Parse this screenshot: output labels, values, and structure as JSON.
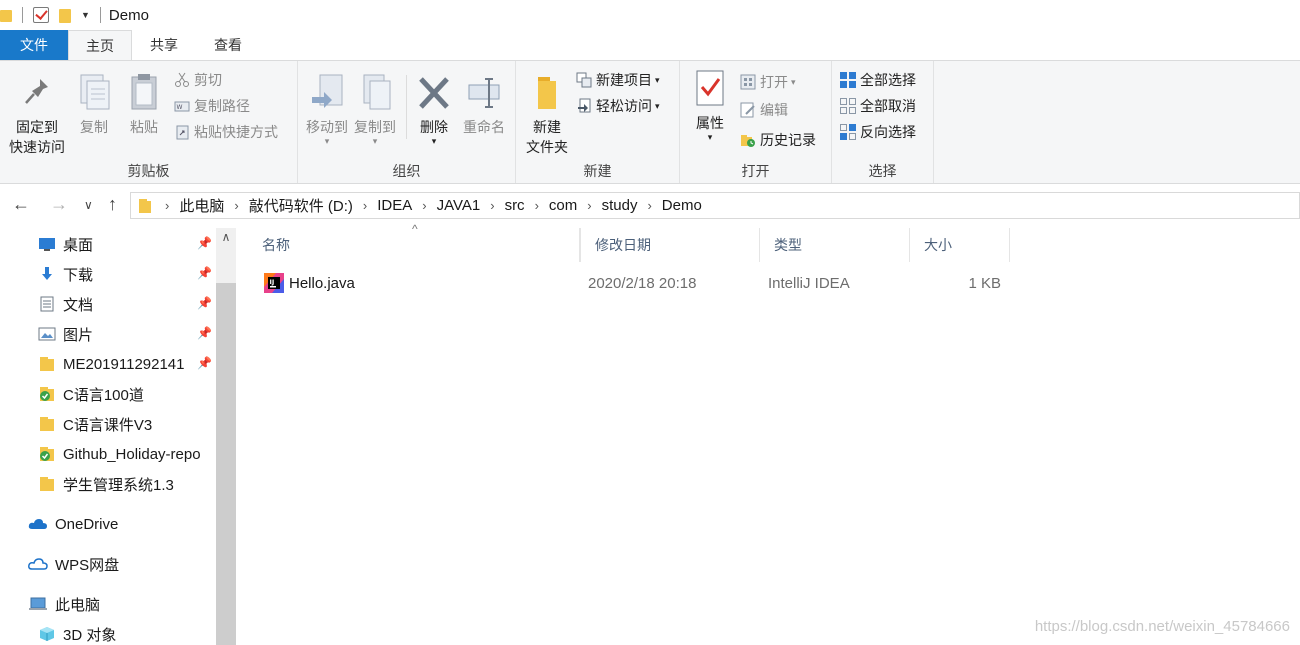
{
  "window": {
    "title": "Demo"
  },
  "quick_access_toolbar": {
    "icons": [
      "folder-icon",
      "properties-check-icon",
      "new-folder-icon",
      "customize-dropdown-icon"
    ]
  },
  "tabs": [
    {
      "label": "文件"
    },
    {
      "label": "主页"
    },
    {
      "label": "共享"
    },
    {
      "label": "查看"
    }
  ],
  "ribbon": {
    "clipboard": {
      "label": "剪贴板",
      "pin_line1": "固定到",
      "pin_line2": "快速访问",
      "copy": "复制",
      "paste": "粘贴",
      "cut": "剪切",
      "copy_path": "复制路径",
      "paste_shortcut": "粘贴快捷方式"
    },
    "organize": {
      "label": "组织",
      "move_to": "移动到",
      "copy_to": "复制到",
      "delete": "删除",
      "rename": "重命名"
    },
    "new": {
      "label": "新建",
      "new_folder_line1": "新建",
      "new_folder_line2": "文件夹",
      "new_item": "新建项目",
      "easy_access": "轻松访问"
    },
    "open": {
      "label": "打开",
      "properties": "属性",
      "open": "打开",
      "edit": "编辑",
      "history": "历史记录"
    },
    "select": {
      "label": "选择",
      "select_all": "全部选择",
      "select_none": "全部取消",
      "invert": "反向选择"
    }
  },
  "address": {
    "breadcrumbs": [
      "此电脑",
      "敲代码软件 (D:)",
      "IDEA",
      "JAVA1",
      "src",
      "com",
      "study",
      "Demo"
    ]
  },
  "nav_pane": {
    "items": [
      {
        "label": "桌面",
        "icon": "desktop-icon",
        "pinned": true
      },
      {
        "label": "下载",
        "icon": "download-icon",
        "pinned": true
      },
      {
        "label": "文档",
        "icon": "documents-icon",
        "pinned": true
      },
      {
        "label": "图片",
        "icon": "pictures-icon",
        "pinned": true
      },
      {
        "label": "ME201911292141",
        "icon": "folder-icon",
        "pinned": true
      },
      {
        "label": "C语言100道",
        "icon": "synced-folder-icon",
        "pinned": false
      },
      {
        "label": "C语言课件V3",
        "icon": "folder-icon",
        "pinned": false
      },
      {
        "label": "Github_Holiday-repo",
        "icon": "synced-folder-icon",
        "pinned": false
      },
      {
        "label": "学生管理系统1.3",
        "icon": "folder-icon",
        "pinned": false
      },
      {
        "label": "OneDrive",
        "icon": "onedrive-icon",
        "pinned": false
      },
      {
        "label": "WPS网盘",
        "icon": "wps-cloud-icon",
        "pinned": false
      },
      {
        "label": "此电脑",
        "icon": "this-pc-icon",
        "pinned": false
      },
      {
        "label": "3D 对象",
        "icon": "3d-objects-icon",
        "pinned": false
      }
    ]
  },
  "file_list": {
    "columns": [
      "名称",
      "修改日期",
      "类型",
      "大小"
    ],
    "rows": [
      {
        "name": "Hello.java",
        "modified": "2020/2/18 20:18",
        "type": "IntelliJ IDEA",
        "size": "1 KB"
      }
    ]
  },
  "watermark": "https://blog.csdn.net/weixin_45784666",
  "colors": {
    "file_tab": "#1979ca",
    "ribbon_bg": "#f5f6f7",
    "column_header_text": "#4c607a",
    "folder": "#f3c64a"
  }
}
